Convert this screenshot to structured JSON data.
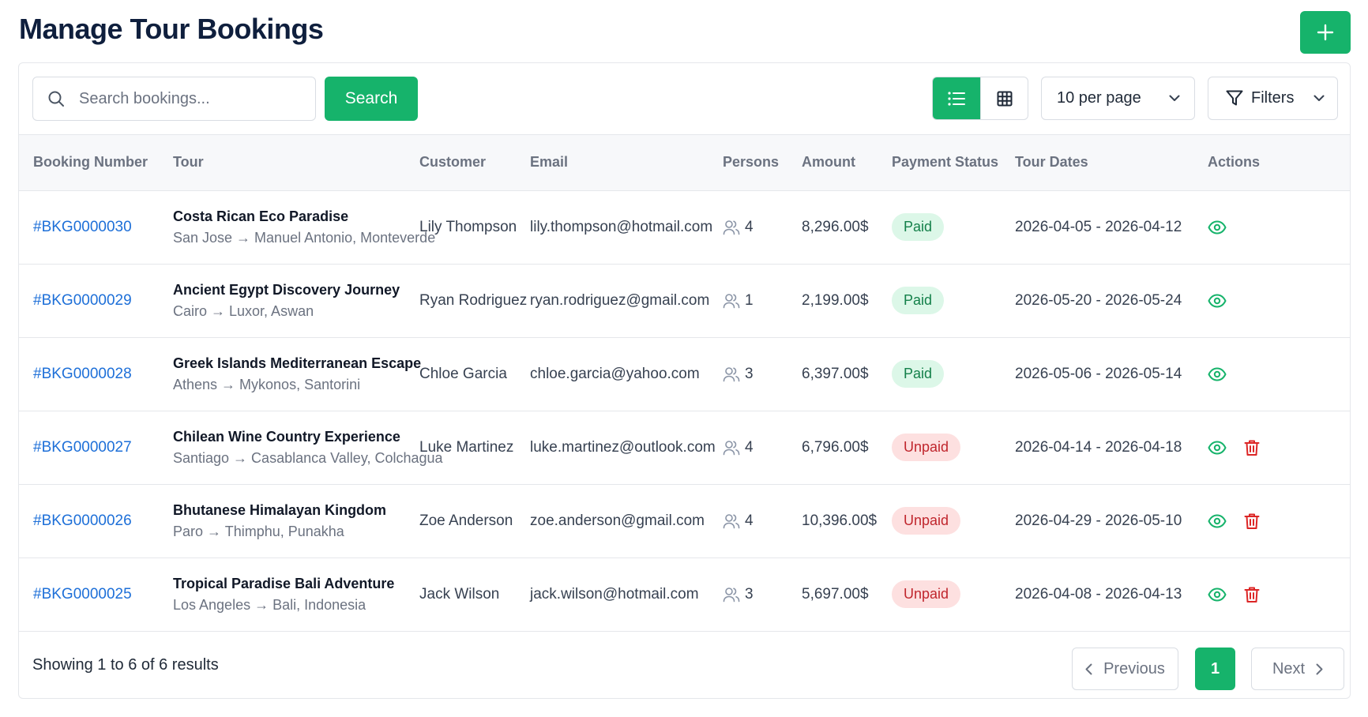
{
  "page": {
    "title": "Manage Tour Bookings",
    "add_icon": "plus-icon"
  },
  "colors": {
    "accent": "#16b36b",
    "link": "#1d6fd8",
    "paid_bg": "#dcf7e8",
    "paid_text": "#14804a",
    "unpaid_bg": "#fde0e0",
    "unpaid_text": "#c0262d",
    "delete": "#dc2626"
  },
  "toolbar": {
    "search_placeholder": "Search bookings...",
    "search_value": "",
    "search_button": "Search",
    "view_modes": [
      "list-icon",
      "grid-icon"
    ],
    "active_view": "list",
    "per_page": "10 per page",
    "filters": "Filters"
  },
  "table": {
    "columns": [
      "Booking Number",
      "Tour",
      "Customer",
      "Email",
      "Persons",
      "Amount",
      "Payment Status",
      "Tour Dates",
      "Actions"
    ],
    "rows": [
      {
        "booking": "#BKG0000030",
        "tour": "Costa Rican Eco Paradise",
        "route": "San Jose → Manuel Antonio, Monteverde",
        "customer": "Lily Thompson",
        "email": "lily.thompson@hotmail.com",
        "persons": "4",
        "amount": "8,296.00$",
        "status": "Paid",
        "dates": "2026-04-05 - 2026-04-12",
        "deletable": false
      },
      {
        "booking": "#BKG0000029",
        "tour": "Ancient Egypt Discovery Journey",
        "route": "Cairo → Luxor, Aswan",
        "customer": "Ryan Rodriguez",
        "email": "ryan.rodriguez@gmail.com",
        "persons": "1",
        "amount": "2,199.00$",
        "status": "Paid",
        "dates": "2026-05-20 - 2026-05-24",
        "deletable": false
      },
      {
        "booking": "#BKG0000028",
        "tour": "Greek Islands Mediterranean Escape",
        "route": "Athens → Mykonos, Santorini",
        "customer": "Chloe Garcia",
        "email": "chloe.garcia@yahoo.com",
        "persons": "3",
        "amount": "6,397.00$",
        "status": "Paid",
        "dates": "2026-05-06 - 2026-05-14",
        "deletable": false
      },
      {
        "booking": "#BKG0000027",
        "tour": "Chilean Wine Country Experience",
        "route": "Santiago → Casablanca Valley, Colchagua",
        "customer": "Luke Martinez",
        "email": "luke.martinez@outlook.com",
        "persons": "4",
        "amount": "6,796.00$",
        "status": "Unpaid",
        "dates": "2026-04-14 - 2026-04-18",
        "deletable": true
      },
      {
        "booking": "#BKG0000026",
        "tour": "Bhutanese Himalayan Kingdom",
        "route": "Paro → Thimphu, Punakha",
        "customer": "Zoe Anderson",
        "email": "zoe.anderson@gmail.com",
        "persons": "4",
        "amount": "10,396.00$",
        "status": "Unpaid",
        "dates": "2026-04-29 - 2026-05-10",
        "deletable": true
      },
      {
        "booking": "#BKG0000025",
        "tour": "Tropical Paradise Bali Adventure",
        "route": "Los Angeles → Bali, Indonesia",
        "customer": "Jack Wilson",
        "email": "jack.wilson@hotmail.com",
        "persons": "3",
        "amount": "5,697.00$",
        "status": "Unpaid",
        "dates": "2026-04-08 - 2026-04-13",
        "deletable": true
      }
    ]
  },
  "footer": {
    "showing": "Showing 1 to 6 of 6 results",
    "previous": "Previous",
    "current_page": "1",
    "next": "Next"
  }
}
